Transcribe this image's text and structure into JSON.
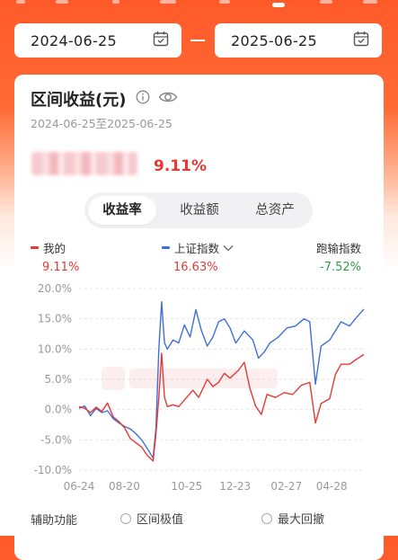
{
  "dates": {
    "start": "2024-06-25",
    "end": "2025-06-25",
    "calendar_icon": "calendar-check-icon",
    "separator": "—"
  },
  "card": {
    "title": "区间收益(元)",
    "date_range": "2024-06-25至2025-06-25",
    "return_rate": "9.11%",
    "amount_blurred": true
  },
  "tabs": [
    "收益率",
    "收益额",
    "总资产"
  ],
  "active_tab": 0,
  "legend": [
    {
      "name": "我的",
      "value": "9.11%",
      "color": "#e53935",
      "value_color": "#e53935"
    },
    {
      "name": "上证指数",
      "value": "16.63%",
      "color": "#3f6fd8",
      "value_color": "#e53935",
      "has_dropdown": true
    },
    {
      "name": "跑输指数",
      "value": "-7.52%",
      "color": "",
      "value_color": "#2e9e3e"
    }
  ],
  "chart_data": {
    "type": "line",
    "y_ticks": [
      "20.0%",
      "15.0%",
      "10.0%",
      "5.0%",
      "0.0%",
      "-5.0%",
      "-10.0%"
    ],
    "ylim": [
      -10,
      20
    ],
    "x_ticks": [
      "06-24",
      "08-20",
      "10-25",
      "12-23",
      "02-27",
      "04-28"
    ],
    "x_tick_positions": [
      0,
      0.159,
      0.378,
      0.548,
      0.728,
      0.887
    ],
    "grid": true,
    "series": [
      {
        "name": "我的",
        "color": "#e53935",
        "points": [
          [
            0,
            0.5
          ],
          [
            0.02,
            0.2
          ],
          [
            0.04,
            -0.5
          ],
          [
            0.06,
            0.4
          ],
          [
            0.08,
            -0.3
          ],
          [
            0.1,
            1.1
          ],
          [
            0.12,
            -1.2
          ],
          [
            0.14,
            -2.0
          ],
          [
            0.16,
            -3.0
          ],
          [
            0.18,
            -4.8
          ],
          [
            0.2,
            -5.5
          ],
          [
            0.22,
            -6.2
          ],
          [
            0.24,
            -7.6
          ],
          [
            0.26,
            -8.5
          ],
          [
            0.27,
            -4.0
          ],
          [
            0.28,
            2.0
          ],
          [
            0.29,
            9.3
          ],
          [
            0.3,
            2.0
          ],
          [
            0.31,
            0.5
          ],
          [
            0.33,
            0.8
          ],
          [
            0.35,
            0.5
          ],
          [
            0.37,
            1.6
          ],
          [
            0.4,
            3.2
          ],
          [
            0.42,
            2.0
          ],
          [
            0.45,
            5.0
          ],
          [
            0.47,
            3.8
          ],
          [
            0.49,
            4.5
          ],
          [
            0.51,
            6.0
          ],
          [
            0.53,
            5.2
          ],
          [
            0.56,
            6.5
          ],
          [
            0.58,
            7.8
          ],
          [
            0.6,
            3.5
          ],
          [
            0.62,
            0.6
          ],
          [
            0.64,
            -0.8
          ],
          [
            0.66,
            2.5
          ],
          [
            0.69,
            2.0
          ],
          [
            0.72,
            2.8
          ],
          [
            0.75,
            2.5
          ],
          [
            0.78,
            4.0
          ],
          [
            0.81,
            4.5
          ],
          [
            0.83,
            -2.2
          ],
          [
            0.85,
            1.0
          ],
          [
            0.88,
            1.8
          ],
          [
            0.9,
            5.8
          ],
          [
            0.92,
            7.5
          ],
          [
            0.95,
            7.5
          ],
          [
            0.97,
            8.2
          ],
          [
            1.0,
            9.1
          ]
        ]
      },
      {
        "name": "上证指数",
        "color": "#3f6fd8",
        "points": [
          [
            0,
            0.2
          ],
          [
            0.02,
            0.6
          ],
          [
            0.04,
            -1.0
          ],
          [
            0.06,
            0.2
          ],
          [
            0.08,
            -0.5
          ],
          [
            0.1,
            -0.2
          ],
          [
            0.12,
            -1.5
          ],
          [
            0.14,
            -2.2
          ],
          [
            0.16,
            -2.8
          ],
          [
            0.18,
            -3.2
          ],
          [
            0.2,
            -4.0
          ],
          [
            0.22,
            -5.0
          ],
          [
            0.24,
            -6.5
          ],
          [
            0.26,
            -8.0
          ],
          [
            0.27,
            -3.0
          ],
          [
            0.28,
            10.0
          ],
          [
            0.29,
            17.8
          ],
          [
            0.3,
            11.0
          ],
          [
            0.31,
            10.0
          ],
          [
            0.33,
            11.5
          ],
          [
            0.35,
            11.0
          ],
          [
            0.37,
            14.0
          ],
          [
            0.39,
            12.0
          ],
          [
            0.41,
            16.5
          ],
          [
            0.43,
            13.0
          ],
          [
            0.45,
            10.5
          ],
          [
            0.47,
            12.0
          ],
          [
            0.49,
            14.5
          ],
          [
            0.51,
            15.0
          ],
          [
            0.53,
            13.5
          ],
          [
            0.55,
            11.0
          ],
          [
            0.58,
            13.0
          ],
          [
            0.61,
            11.5
          ],
          [
            0.63,
            8.5
          ],
          [
            0.65,
            9.5
          ],
          [
            0.67,
            11.0
          ],
          [
            0.7,
            12.0
          ],
          [
            0.73,
            13.5
          ],
          [
            0.76,
            13.8
          ],
          [
            0.79,
            15.0
          ],
          [
            0.81,
            14.5
          ],
          [
            0.83,
            4.2
          ],
          [
            0.85,
            10.5
          ],
          [
            0.88,
            11.5
          ],
          [
            0.9,
            13.0
          ],
          [
            0.92,
            14.5
          ],
          [
            0.95,
            13.8
          ],
          [
            0.97,
            15.0
          ],
          [
            1.0,
            16.6
          ]
        ]
      }
    ]
  },
  "aux": {
    "label": "辅助功能",
    "options": [
      "区间极值",
      "最大回撤"
    ]
  }
}
